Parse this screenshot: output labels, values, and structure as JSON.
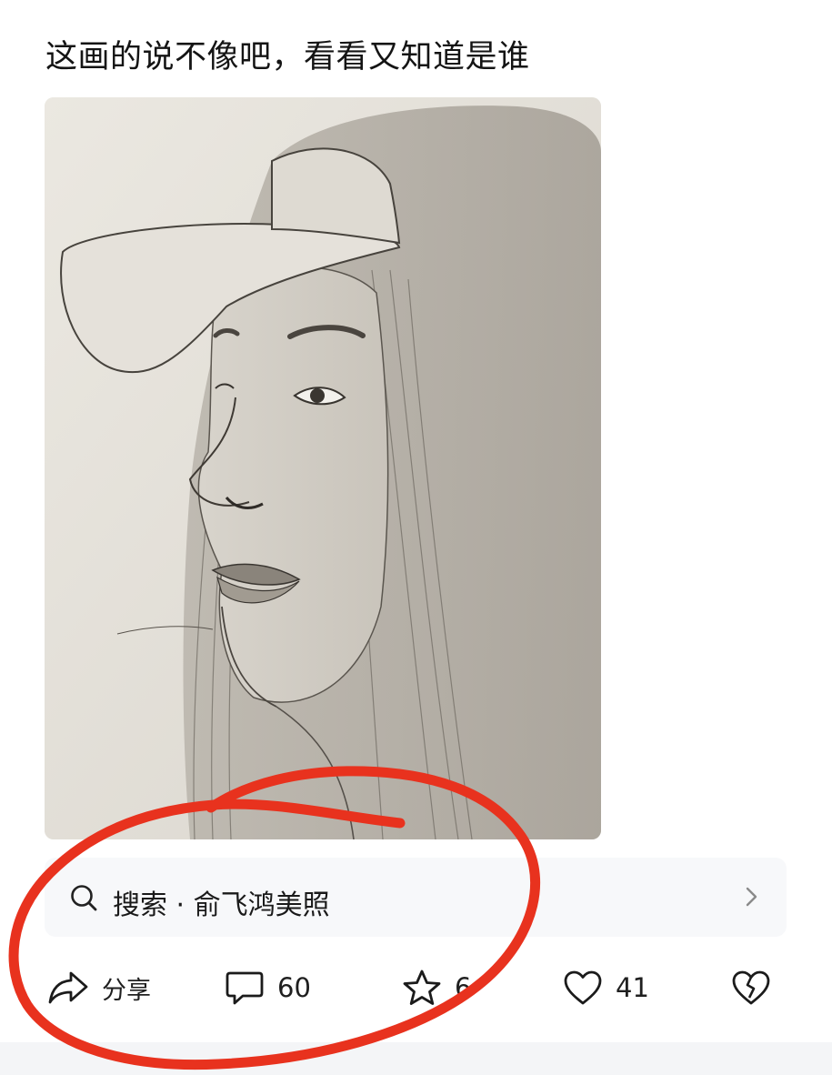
{
  "post": {
    "title": "这画的说不像吧，看看又知道是谁",
    "image_icon": "pencil-sketch-portrait"
  },
  "search": {
    "icon": "search-icon",
    "query_text": "搜索 · 俞飞鸿美照",
    "chevron_icon": "chevron-right-icon"
  },
  "actions": {
    "share": {
      "icon": "share-arrow-icon",
      "label": "分享"
    },
    "comment": {
      "icon": "comment-bubble-icon",
      "count": "60"
    },
    "favorite": {
      "icon": "star-icon",
      "count": "6"
    },
    "like": {
      "icon": "heart-icon",
      "count": "41"
    },
    "dislike": {
      "icon": "broken-heart-icon"
    }
  },
  "colors": {
    "annotation_red": "#e8321e",
    "search_bg": "#f7f8fa",
    "text_primary": "#141414"
  }
}
